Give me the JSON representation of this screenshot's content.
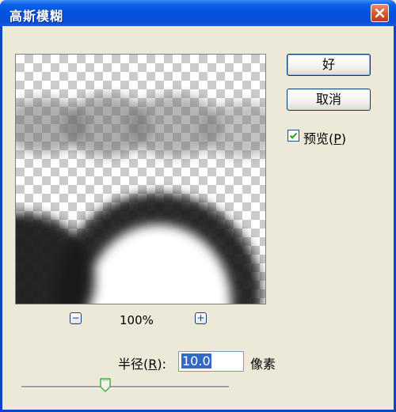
{
  "dialog": {
    "title": "高斯模糊",
    "ok_label": "好",
    "cancel_label": "取消",
    "preview_checked": true,
    "preview_label_prefix": "预览(",
    "preview_label_key": "P",
    "preview_label_suffix": ")"
  },
  "zoom": {
    "minus": "−",
    "plus": "+",
    "value": "100%"
  },
  "radius": {
    "label_prefix": "半径(",
    "label_key": "R",
    "label_suffix": "):",
    "value": "10.0",
    "unit": "像素",
    "slider_fraction": 0.4
  },
  "colors": {
    "titlebar": "#0452e0",
    "close": "#d6552f",
    "selection": "#316ac5",
    "dialog_bg": "#ece9d8"
  },
  "icons": {
    "close": "close-icon",
    "checkbox": "checkmark-icon",
    "zoom_out": "zoom-out-icon",
    "zoom_in": "zoom-in-icon",
    "slider": "slider-thumb-icon"
  }
}
